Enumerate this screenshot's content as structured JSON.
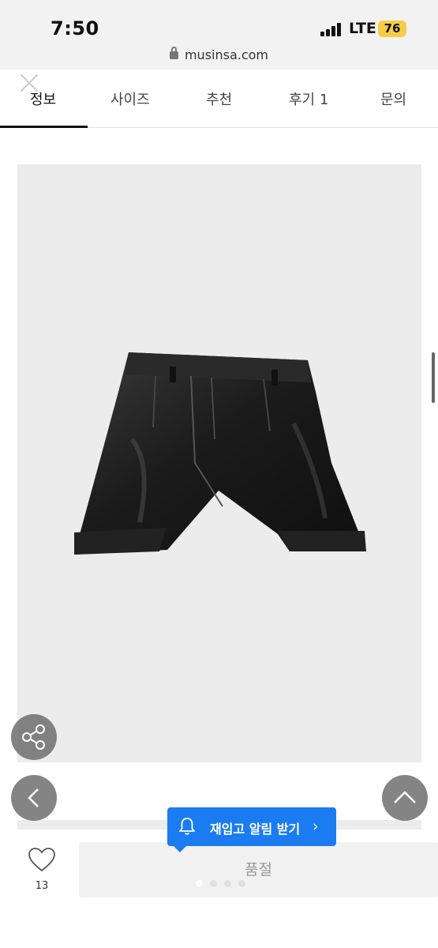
{
  "status_bar": {
    "time": "7:50",
    "network": "LTE",
    "battery": "76",
    "url": "musinsa.com"
  },
  "tabs": [
    {
      "label": "정보",
      "active": true
    },
    {
      "label": "사이즈",
      "active": false
    },
    {
      "label": "추천",
      "active": false
    },
    {
      "label": "후기 1",
      "active": false
    },
    {
      "label": "문의",
      "active": false
    }
  ],
  "product": {
    "image_icon": "leather-shorts-image"
  },
  "restock_alert": {
    "label": "재입고 알림 받기",
    "chevron": "›"
  },
  "bottom_bar": {
    "like_count": "13",
    "soldout_label": "품절"
  },
  "colors": {
    "accent": "#1b7cf2",
    "battery": "#f7cd45"
  }
}
